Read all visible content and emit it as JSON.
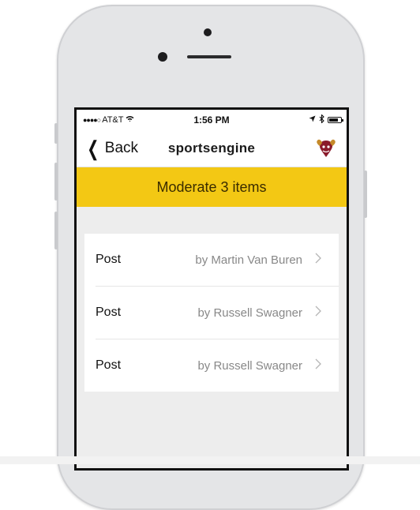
{
  "status_bar": {
    "signal": "●●●●○",
    "carrier": "AT&T",
    "wifi_icon": "wifi-icon",
    "time": "1:56 PM",
    "location_icon": "location-arrow-icon",
    "bluetooth_icon": "bluetooth-icon",
    "battery_icon": "battery-icon"
  },
  "nav": {
    "back_label": "Back",
    "brand": "sportsengine",
    "team_logo_icon": "team-logo-icon"
  },
  "banner": {
    "text": "Moderate 3 items",
    "color": "#f3c814"
  },
  "items": [
    {
      "type": "Post",
      "author": "by Martin Van Buren"
    },
    {
      "type": "Post",
      "author": "by Russell Swagner"
    },
    {
      "type": "Post",
      "author": "by Russell Swagner"
    }
  ]
}
